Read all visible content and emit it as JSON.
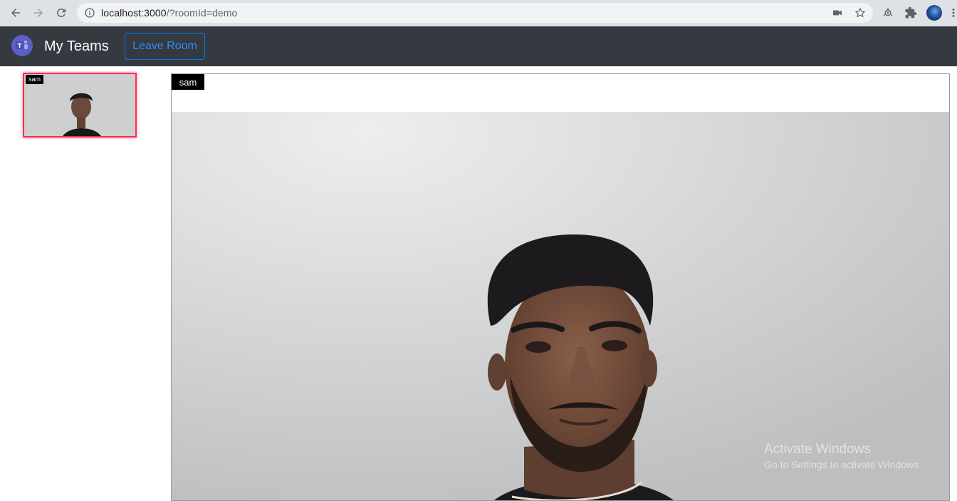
{
  "browser": {
    "url_host": "localhost:3000",
    "url_path": "/?roomId=demo",
    "icons": [
      "back-arrow-icon",
      "forward-arrow-icon",
      "reload-icon",
      "info-icon",
      "camera-icon",
      "star-icon",
      "extension-lens-icon",
      "puzzle-icon",
      "profile-avatar",
      "more-icon"
    ]
  },
  "app": {
    "brand": "My Teams",
    "leave_button": "Leave Room",
    "accent_color": "#007bff",
    "navbar_color": "#343a40"
  },
  "participants": {
    "thumbnail": {
      "name": "sam",
      "border_color": "#ff2d55"
    },
    "main": {
      "name": "sam"
    }
  },
  "watermark": {
    "line1": "Activate Windows",
    "line2": "Go to Settings to activate Windows."
  }
}
